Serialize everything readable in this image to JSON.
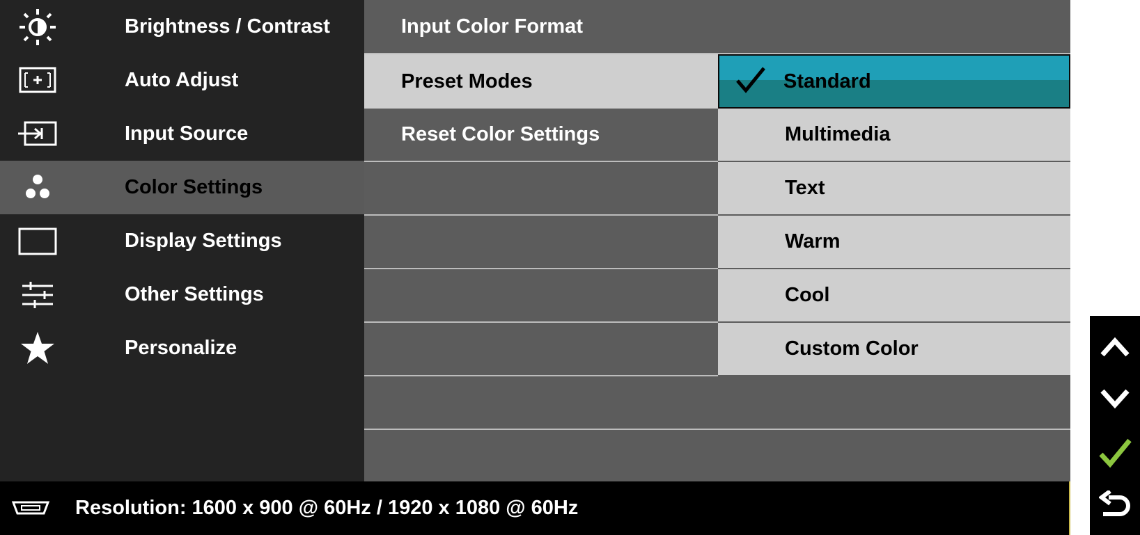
{
  "left_menu": {
    "items": [
      {
        "label": "Brightness / Contrast",
        "icon": "brightness-icon"
      },
      {
        "label": "Auto Adjust",
        "icon": "auto-adjust-icon"
      },
      {
        "label": "Input Source",
        "icon": "input-source-icon"
      },
      {
        "label": "Color Settings",
        "icon": "color-settings-icon",
        "active": true
      },
      {
        "label": "Display Settings",
        "icon": "display-settings-icon"
      },
      {
        "label": "Other Settings",
        "icon": "other-settings-icon"
      },
      {
        "label": "Personalize",
        "icon": "star-icon"
      }
    ]
  },
  "color_settings": {
    "items": [
      {
        "label": "Input Color Format"
      },
      {
        "label": "Preset Modes",
        "selected": true
      },
      {
        "label": "Reset Color Settings"
      }
    ]
  },
  "preset_modes": {
    "options": [
      {
        "label": "Standard",
        "current": true
      },
      {
        "label": "Multimedia"
      },
      {
        "label": "Text"
      },
      {
        "label": "Warm"
      },
      {
        "label": "Cool"
      },
      {
        "label": "Custom Color"
      }
    ]
  },
  "status_bar": {
    "icon": "vga-connector-icon",
    "resolution": "Resolution:  1600 x 900 @ 60Hz / 1920 x 1080 @ 60Hz"
  },
  "nav_buttons": [
    {
      "icon": "up-arrow-icon"
    },
    {
      "icon": "down-arrow-icon"
    },
    {
      "icon": "confirm-check-icon",
      "color": "#8cc63f"
    },
    {
      "icon": "back-arrow-icon"
    }
  ],
  "colors": {
    "highlight_top": "#1f9fb7",
    "highlight_bottom": "#1a7f85",
    "menu_bg": "#232323",
    "panel_bg": "#5c5c5c",
    "selected_bg": "#cfcfcf",
    "check_green": "#8cc63f"
  }
}
